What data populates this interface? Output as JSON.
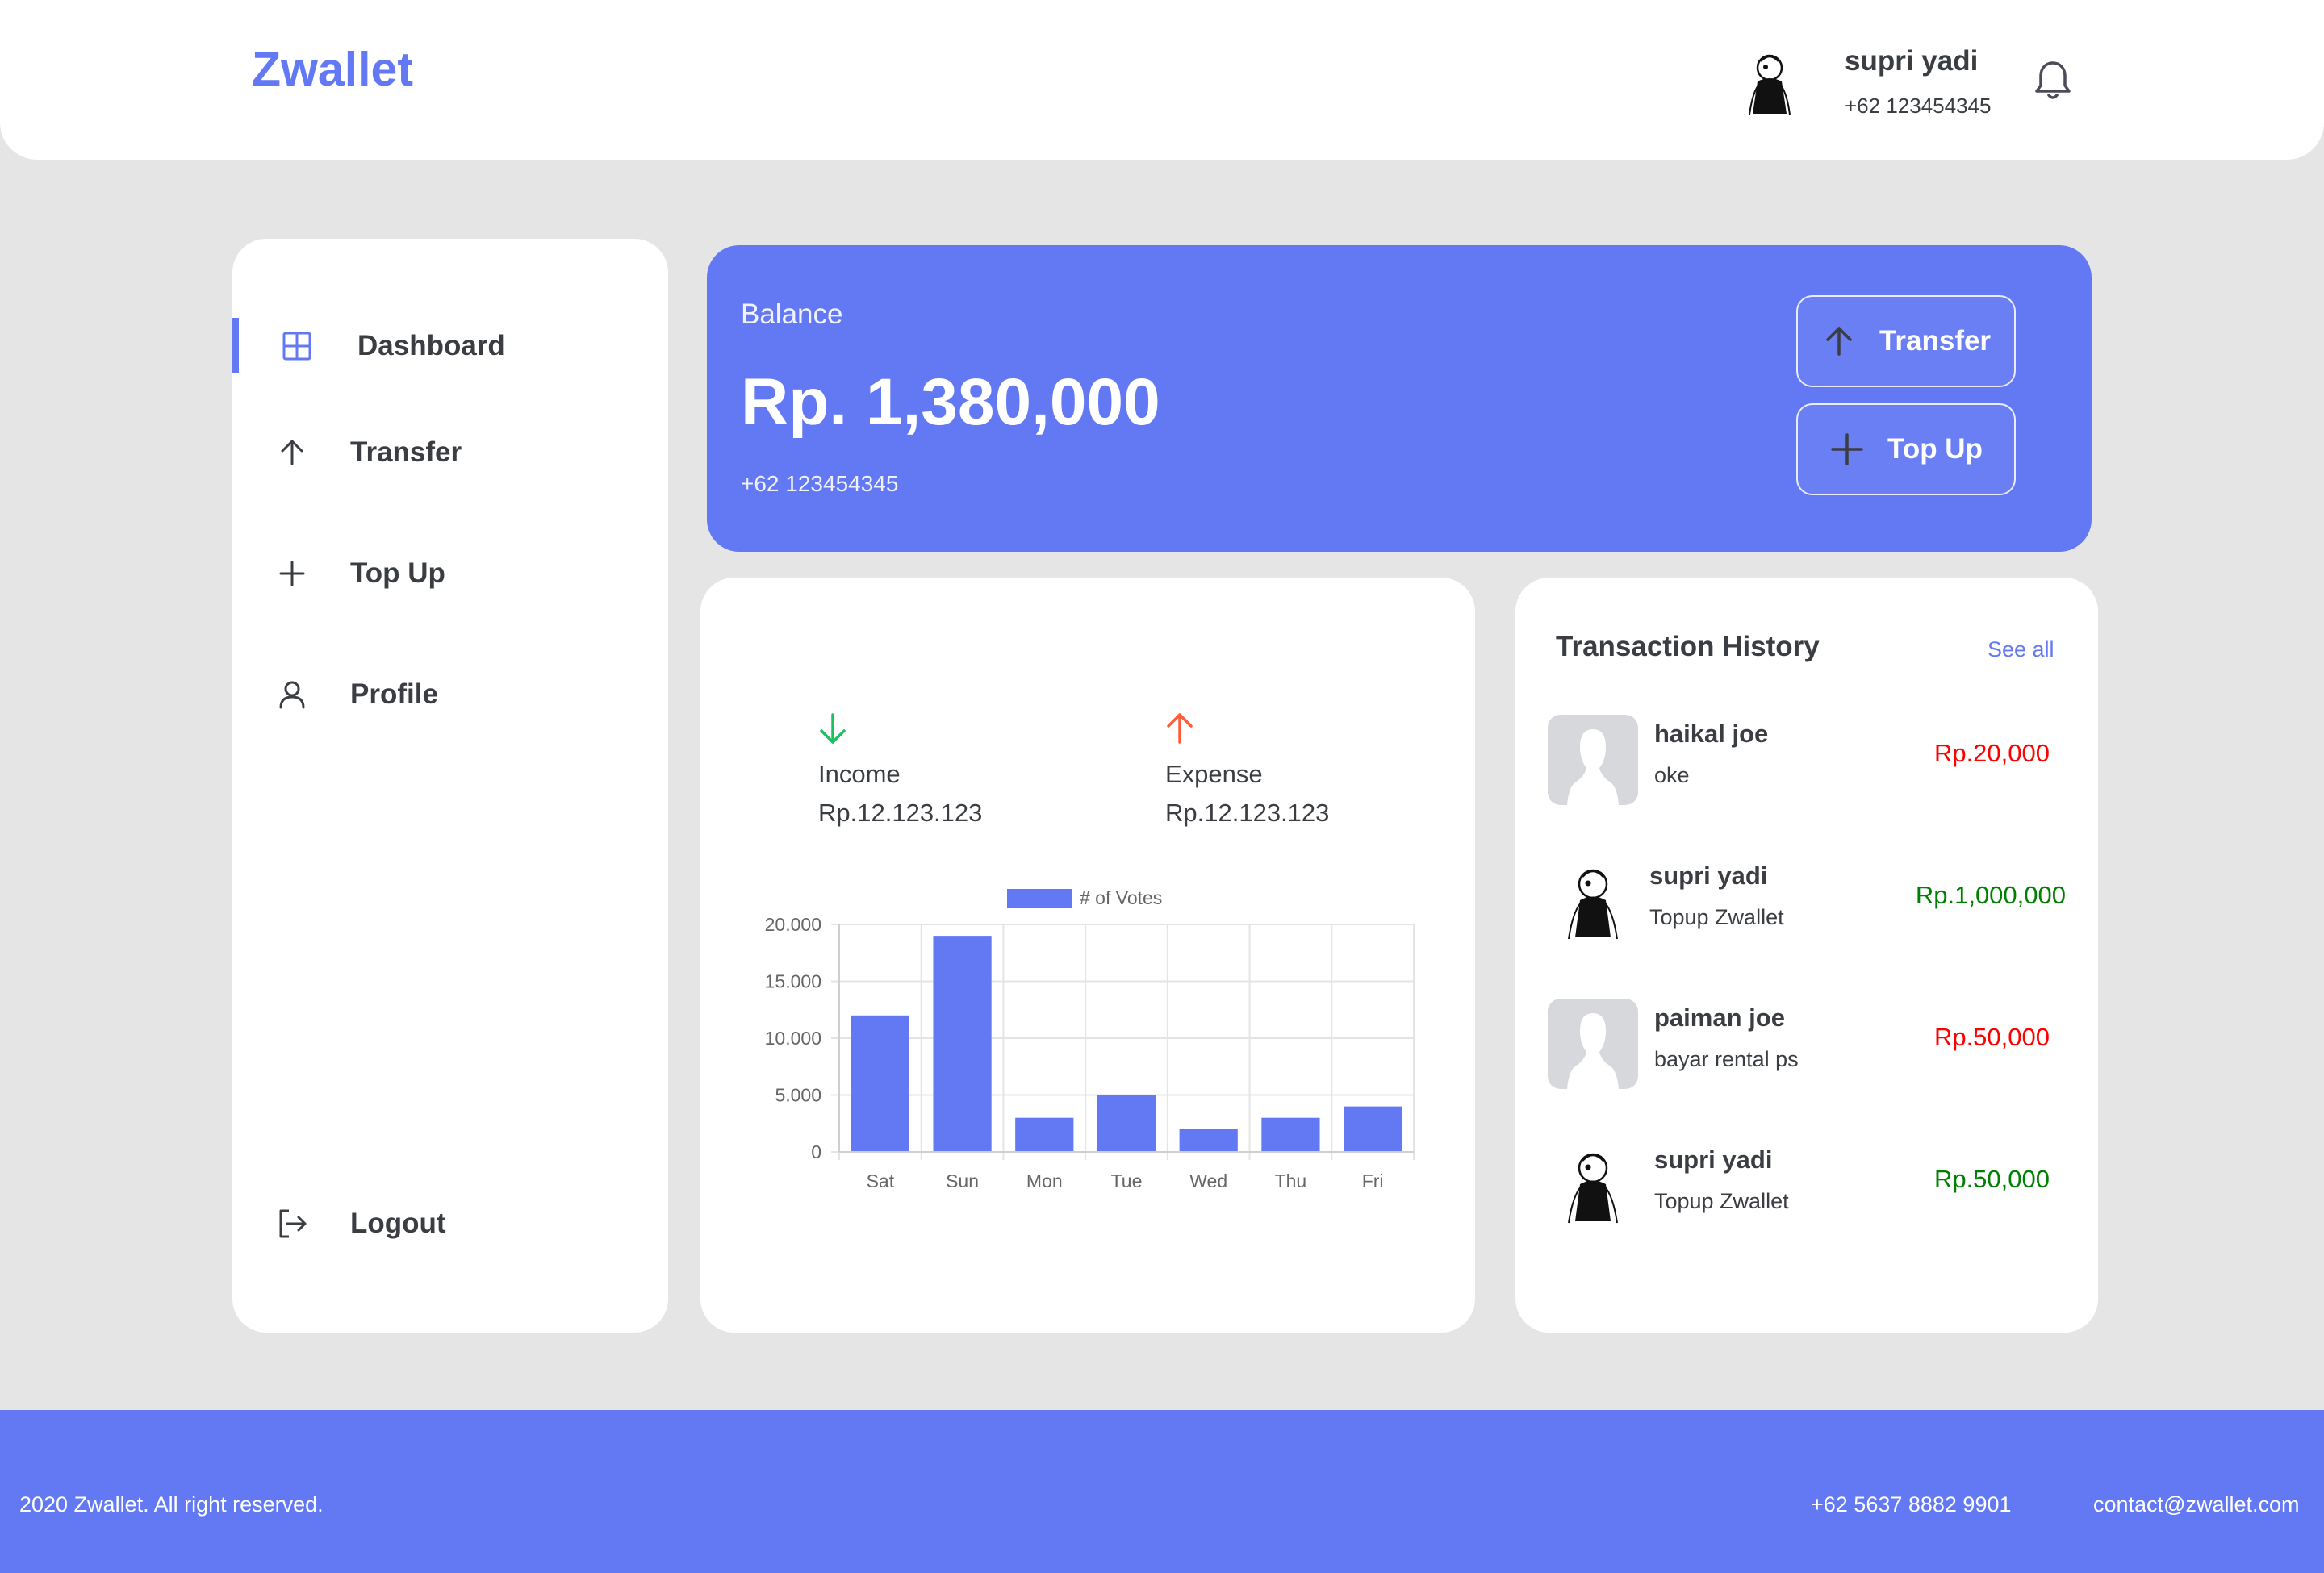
{
  "header": {
    "brand": "Zwallet",
    "user_name": "supri yadi",
    "user_phone": "+62 123454345",
    "bell_icon": "bell-icon"
  },
  "sidebar": {
    "items": [
      {
        "label": "Dashboard",
        "icon": "grid-icon",
        "active": true
      },
      {
        "label": "Transfer",
        "icon": "arrow-up-icon",
        "active": false
      },
      {
        "label": "Top Up",
        "icon": "plus-icon",
        "active": false
      },
      {
        "label": "Profile",
        "icon": "user-icon",
        "active": false
      }
    ],
    "logout_label": "Logout"
  },
  "balance": {
    "label": "Balance",
    "amount": "Rp. 1,380,000",
    "phone": "+62 123454345",
    "transfer_label": "Transfer",
    "topup_label": "Top Up"
  },
  "stats": {
    "income_label": "Income",
    "income_value": "Rp.12.123.123",
    "expense_label": "Expense",
    "expense_value": "Rp.12.123.123"
  },
  "chart_data": {
    "type": "bar",
    "categories": [
      "Sat",
      "Sun",
      "Mon",
      "Tue",
      "Wed",
      "Thu",
      "Fri"
    ],
    "series": [
      {
        "name": "# of Votes",
        "values": [
          12000,
          19000,
          3000,
          5000,
          2000,
          3000,
          4000
        ]
      }
    ],
    "ylim": [
      0,
      20000
    ],
    "yticks": [
      "0",
      "5.000",
      "10.000",
      "15.000",
      "20.000"
    ],
    "grid": true,
    "legend": "top",
    "color": "#6379f4"
  },
  "history": {
    "title": "Transaction History",
    "see_all": "See all",
    "transactions": [
      {
        "name": "haikal joe",
        "note": "oke",
        "amount": "Rp.20,000",
        "type": "expense",
        "avatar": "placeholder"
      },
      {
        "name": "supri yadi",
        "note": "Topup Zwallet",
        "amount": "Rp.1,000,000",
        "type": "income",
        "avatar": "illustration"
      },
      {
        "name": "paiman joe",
        "note": "bayar rental ps",
        "amount": "Rp.50,000",
        "type": "expense",
        "avatar": "placeholder"
      },
      {
        "name": "supri yadi",
        "note": "Topup Zwallet",
        "amount": "Rp.50,000",
        "type": "income",
        "avatar": "illustration"
      }
    ]
  },
  "footer": {
    "copyright": "2020 Zwallet. All right reserved.",
    "phone": "+62 5637 8882 9901",
    "email": "contact@zwallet.com"
  },
  "colors": {
    "accent": "#6379f4",
    "income": "#1ec15f",
    "expense": "#ff5b37",
    "amount_expense": "#ff0000",
    "amount_income": "#008000"
  }
}
